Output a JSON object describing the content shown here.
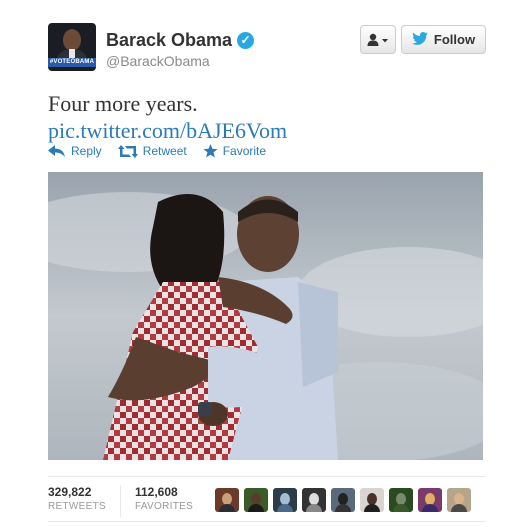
{
  "profile": {
    "name": "Barack Obama",
    "handle": "@BarackObama",
    "avatar_banner": "#VOTEOBAMA",
    "verified_icon": "check-icon"
  },
  "buttons": {
    "user_menu_icon": "person-dropdown-icon",
    "follow_label": "Follow"
  },
  "tweet": {
    "text": "Four more years.",
    "link": "pic.twitter.com/bAJE6Vom"
  },
  "actions": {
    "reply": "Reply",
    "retweet": "Retweet",
    "favorite": "Favorite"
  },
  "stats": {
    "retweets_count": "329,822",
    "retweets_label": "RETWEETS",
    "favorites_count": "112,608",
    "favorites_label": "FAVORITES"
  },
  "colors": {
    "link": "#2b7bb9",
    "verified": "#2aa9e0"
  }
}
